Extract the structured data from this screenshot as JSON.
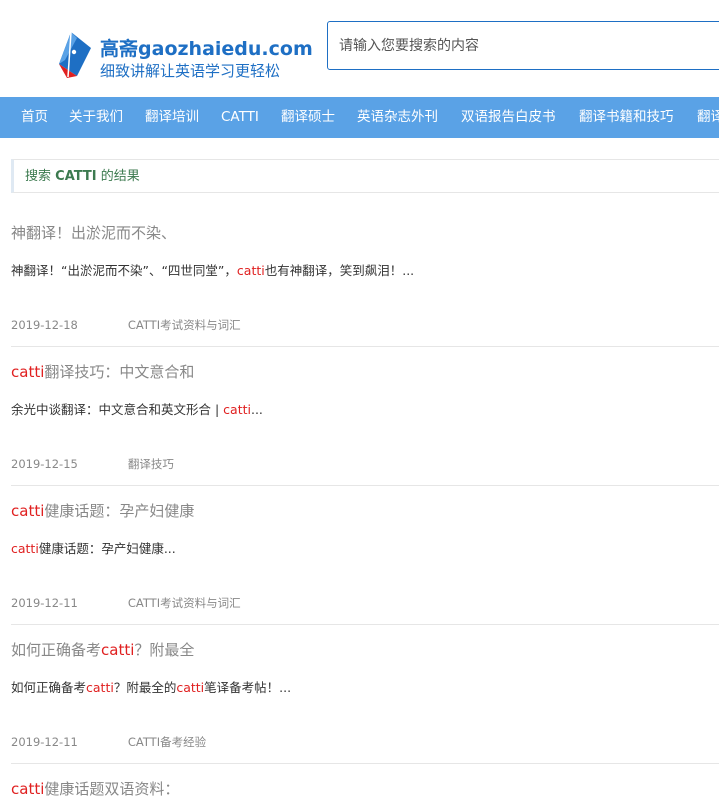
{
  "site": {
    "brand_cn": "高斋",
    "brand_domain": "gaozhaiedu.com",
    "tagline": "细致讲解让英语学习更轻松",
    "colors": {
      "brand": "#1e6fc4",
      "nav": "#5aa2e6",
      "highlight": "#e02020"
    }
  },
  "search": {
    "placeholder": "请输入您要搜索的内容"
  },
  "nav": {
    "items": [
      {
        "label": "首页"
      },
      {
        "label": "关于我们"
      },
      {
        "label": "翻译培训"
      },
      {
        "label": "CATTI"
      },
      {
        "label": "翻译硕士"
      },
      {
        "label": "英语杂志外刊"
      },
      {
        "label": "双语报告白皮书"
      },
      {
        "label": "翻译书籍和技巧"
      },
      {
        "label": "翻译"
      }
    ]
  },
  "crumb": {
    "prefix": "搜索",
    "keyword": "CATTI",
    "suffix": "的结果"
  },
  "results": [
    {
      "title_pre": "神翻译！出淤泥而不染、",
      "desc_pre": "神翻译！“出淤泥而不染”、“四世同堂”，",
      "desc_hl": "catti",
      "desc_post": "也有神翻译，笑到飙泪！...",
      "date": "2019-12-18",
      "category": "CATTI考试资料与词汇"
    },
    {
      "title_hl": "catti",
      "title_post": "翻译技巧：中文意合和",
      "desc_pre": "余光中谈翻译：中文意合和英文形合 | ",
      "desc_hl": "catti",
      "desc_post": "...",
      "date": "2019-12-15",
      "category": "翻译技巧"
    },
    {
      "title_hl": "catti",
      "title_post": "健康话题：孕产妇健康",
      "desc_hl": "catti",
      "desc_post": "健康话题：孕产妇健康...",
      "date": "2019-12-11",
      "category": "CATTI考试资料与词汇"
    },
    {
      "title_pre": "如何正确备考",
      "title_hl": "catti",
      "title_post": "？附最全",
      "desc_pre": "如何正确备考",
      "desc_hl": "catti",
      "desc_mid": "？附最全的",
      "desc_hl2": "catti",
      "desc_post": "笔译备考帖！...",
      "date": "2019-12-11",
      "category": "CATTI备考经验"
    },
    {
      "title_hl": "catti",
      "title_post": "健康话题双语资料："
    }
  ]
}
